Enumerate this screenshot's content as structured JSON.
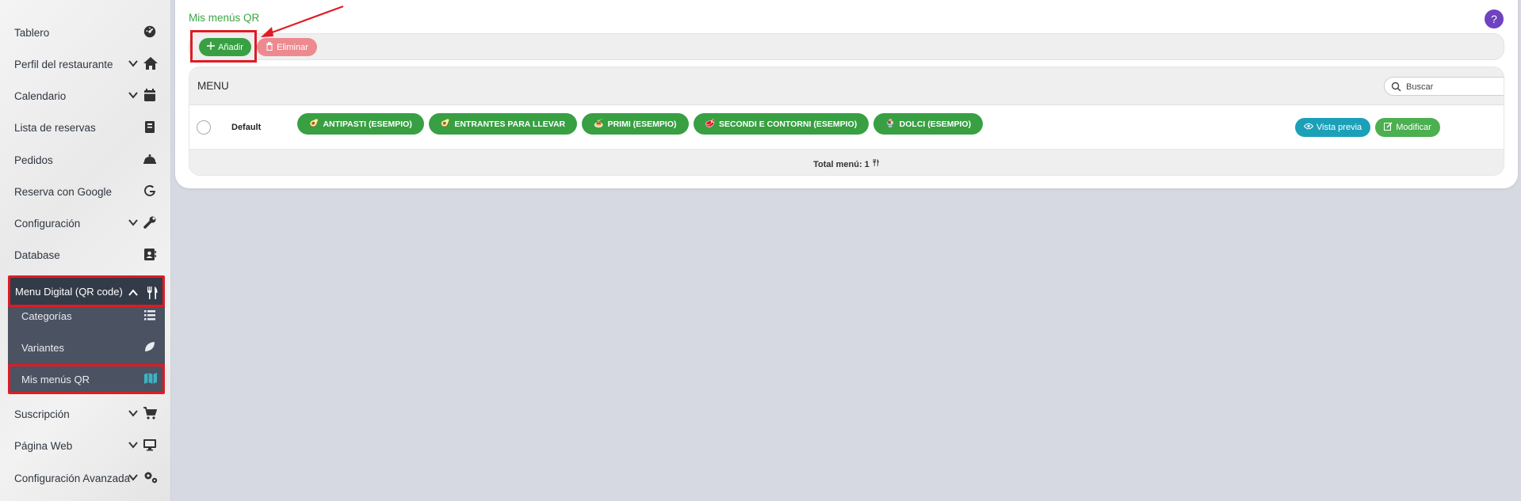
{
  "sidebar": {
    "items": [
      {
        "label": "Tablero",
        "icon": "dashboard-icon",
        "chevron": false
      },
      {
        "label": "Perfil del restaurante",
        "icon": "home-icon",
        "chevron": true
      },
      {
        "label": "Calendario",
        "icon": "calendar-icon",
        "chevron": true
      },
      {
        "label": "Lista de reservas",
        "icon": "book-icon",
        "chevron": false
      },
      {
        "label": "Pedidos",
        "icon": "bell-icon",
        "chevron": false
      },
      {
        "label": "Reserva con Google",
        "icon": "google-icon",
        "chevron": false
      },
      {
        "label": "Configuración",
        "icon": "wrench-icon",
        "chevron": true
      },
      {
        "label": "Database",
        "icon": "address-book-icon",
        "chevron": false
      },
      {
        "label": "Menu Digital (QR code)",
        "icon": "utensils-icon",
        "chevron": true
      },
      {
        "label": "Suscripción",
        "icon": "cart-icon",
        "chevron": true
      },
      {
        "label": "Página Web",
        "icon": "monitor-icon",
        "chevron": true
      },
      {
        "label": "Configuración Avanzada",
        "icon": "gears-icon",
        "chevron": true
      }
    ],
    "submenu": [
      {
        "label": "Categorías",
        "icon": "list-icon"
      },
      {
        "label": "Variantes",
        "icon": "leaf-icon"
      },
      {
        "label": "Mis menús QR",
        "icon": "map-icon"
      }
    ]
  },
  "page": {
    "title": "Mis menús QR",
    "help": "?"
  },
  "toolbar": {
    "add_label": "Añadir",
    "delete_label": "Eliminar"
  },
  "table": {
    "header": "MENU",
    "search_placeholder": "Buscar",
    "rows": [
      {
        "name": "Default",
        "categories": [
          {
            "emoji": "🥑",
            "label": "ANTIPASTI (ESEMPIO)"
          },
          {
            "emoji": "🥑",
            "label": "ENTRANTES PARA LLEVAR"
          },
          {
            "emoji": "🍝",
            "label": "PRIMI (ESEMPIO)"
          },
          {
            "emoji": "🥩",
            "label": "SECONDI E CONTORNI (ESEMPIO)"
          },
          {
            "emoji": "🍨",
            "label": "DOLCI (ESEMPIO)"
          }
        ],
        "preview_label": "Vista previa",
        "edit_label": "Modificar"
      }
    ],
    "total_label": "Total menú: 1"
  },
  "colors": {
    "accent_green": "#38a043",
    "danger": "#ec8a8f",
    "info": "#1ba0b8",
    "help": "#6f42c1",
    "highlight": "#e01b24",
    "sidebar_active": "#343b48"
  }
}
